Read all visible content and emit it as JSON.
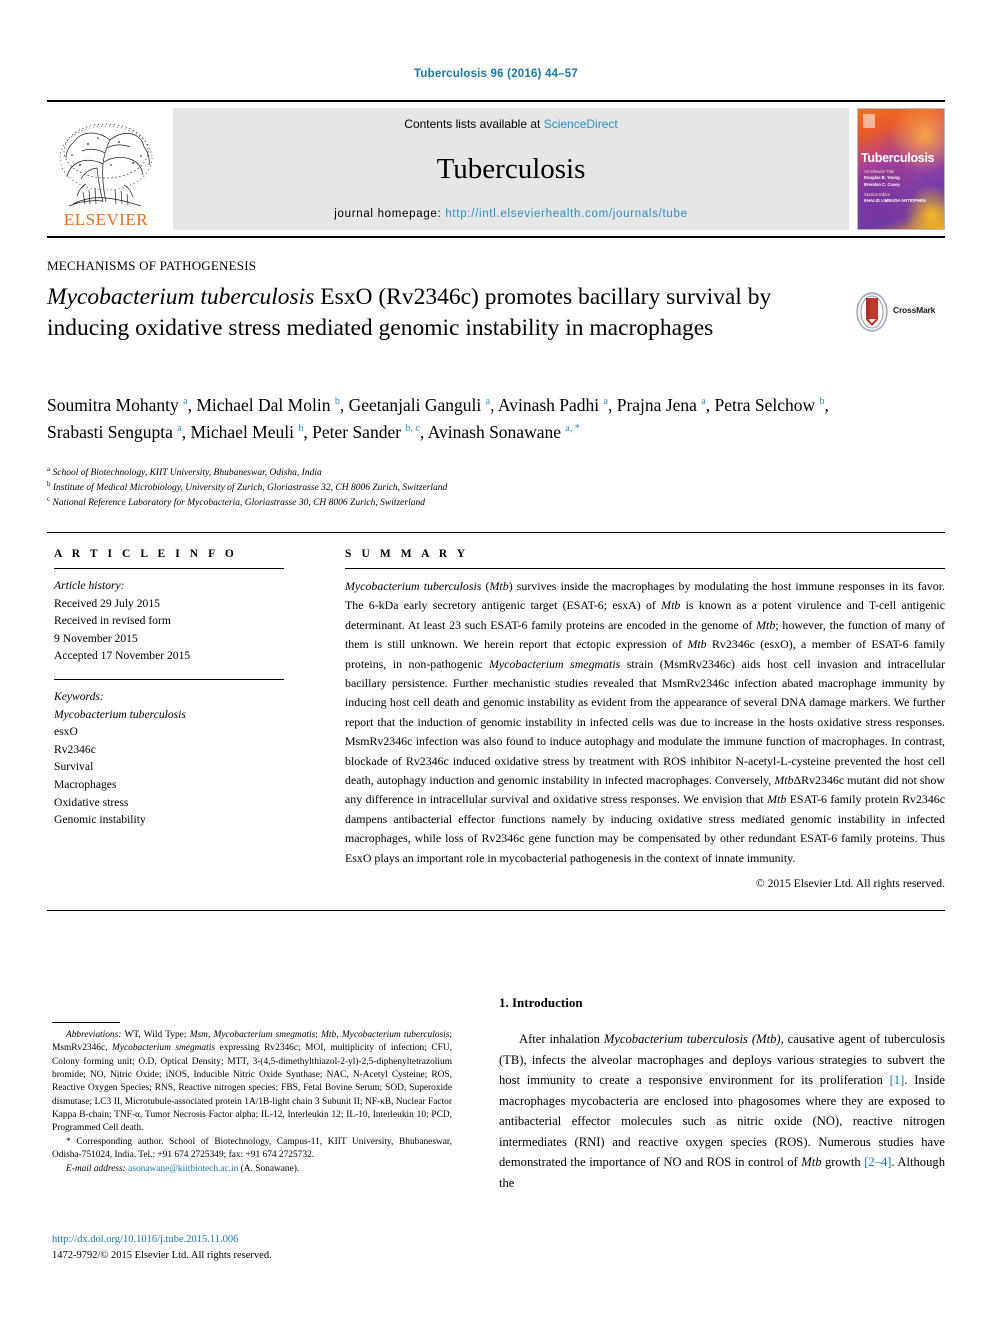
{
  "running_head": "Tuberculosis 96 (2016) 44–57",
  "masthead": {
    "contents_prefix": "Contents lists available at ",
    "contents_link": "ScienceDirect",
    "journal_name": "Tuberculosis",
    "homepage_prefix": "journal homepage: ",
    "homepage_url": "http://intl.elsevierhealth.com/journals/tube",
    "publisher": "ELSEVIER",
    "cover": {
      "title": "Tuberculosis",
      "line1": "An Elsevier Title",
      "line2": "Douglas B. Young",
      "line3": "Brendan C. Casey",
      "line4": "Section Editor",
      "line5": "KHALID LIMBADA ANTIOPHEN"
    }
  },
  "section_label": "MECHANISMS OF PATHOGENESIS",
  "title": {
    "part_italic_1": "Mycobacterium tuberculosis",
    "part_rest": " EsxO (Rv2346c) promotes bacillary survival by inducing oxidative stress mediated genomic instability in macrophages"
  },
  "crossmark": {
    "label": "CrossMark"
  },
  "authors": [
    {
      "name": "Soumitra Mohanty",
      "sup": "a",
      "sep": ", "
    },
    {
      "name": "Michael Dal Molin",
      "sup": "b",
      "sep": ", "
    },
    {
      "name": "Geetanjali Ganguli",
      "sup": "a",
      "sep": ", "
    },
    {
      "name": "Avinash Padhi",
      "sup": "a",
      "sep": ", "
    },
    {
      "name": "Prajna Jena",
      "sup": "a",
      "sep": ", "
    },
    {
      "name": "Petra Selchow",
      "sup": "b",
      "sep": ", "
    },
    {
      "name": "Srabasti Sengupta",
      "sup": "a",
      "sep": ", "
    },
    {
      "name": "Michael Meuli",
      "sup": "b",
      "sep": ", "
    },
    {
      "name": "Peter Sander",
      "sup": "b, c",
      "sep": ", "
    },
    {
      "name": "Avinash Sonawane",
      "sup": "a, *",
      "sep": ""
    }
  ],
  "affiliations": [
    {
      "sup": "a",
      "text": "School of Biotechnology, KIIT University, Bhubaneswar, Odisha, India"
    },
    {
      "sup": "b",
      "text": "Institute of Medical Microbiology, University of Zurich, Gloriastrasse 32, CH 8006 Zurich, Switzerland"
    },
    {
      "sup": "c",
      "text": "National Reference Laboratory for Mycobacteria, Gloriastrasse 30, CH 8006 Zurich, Switzerland"
    }
  ],
  "article_info": {
    "heading": "A R T I C L E   I N F O",
    "history_label": "Article history:",
    "history": [
      "Received 29 July 2015",
      "Received in revised form",
      "9 November 2015",
      "Accepted 17 November 2015"
    ],
    "keywords_label": "Keywords:",
    "keywords": [
      "Mycobacterium tuberculosis",
      "esxO",
      "Rv2346c",
      "Survival",
      "Macrophages",
      "Oxidative stress",
      "Genomic instability"
    ]
  },
  "summary": {
    "heading": "S U M M A R Y",
    "body_html": "<i>Mycobacterium tuberculosis</i> (<i>Mtb</i>) survives inside the macrophages by modulating the host immune responses in its favor. The 6-kDa early secretory antigenic target (ESAT-6; esxA) of <i>Mtb</i> is known as a potent virulence and T-cell antigenic determinant. At least 23 such ESAT-6 family proteins are encoded in the genome of <i>Mtb</i>; however, the function of many of them is still unknown. We herein report that ectopic expression of <i>Mtb</i> Rv2346c (esxO), a member of ESAT-6 family proteins, in non-pathogenic <i>Mycobacterium smegmatis</i> strain (MsmRv2346c) aids host cell invasion and intracellular bacillary persistence. Further mechanistic studies revealed that MsmRv2346c infection abated macrophage immunity by inducing host cell death and genomic instability as evident from the appearance of several DNA damage markers. We further report that the induction of genomic instability in infected cells was due to increase in the hosts oxidative stress responses. MsmRv2346c infection was also found to induce autophagy and modulate the immune function of macrophages. In contrast, blockade of Rv2346c induced oxidative stress by treatment with ROS inhibitor N-acetyl-L-cysteine prevented the host cell death, autophagy induction and genomic instability in infected macrophages. Conversely, <i>Mtb</i>ΔRv2346c mutant did not show any difference in intracellular survival and oxidative stress responses. We envision that <i>Mtb</i> ESAT-6 family protein Rv2346c dampens antibacterial effector functions namely by inducing oxidative stress mediated genomic instability in infected macrophages, while loss of Rv2346c gene function may be compensated by other redundant ESAT-6 family proteins. Thus EsxO plays an important role in mycobacterial pathogenesis in the context of innate immunity.",
    "copyright": "© 2015 Elsevier Ltd. All rights reserved."
  },
  "footnotes": {
    "abbreviations_html": "<i>Abbreviations:</i> WT, Wild Type; <i>Msm</i>, <i>Mycobacterium smegmatis</i>; <i>Mtb</i>, <i>Mycobacterium tuberculosis</i>; MsmRv2346c, <i>Mycobacterium smegmatis</i> expressing Rv2346c; MOI, multiplicity of infection; CFU, Colony forming unit; O.D, Optical Density; MTT, 3-(4,5-dimethylthiazol-2-yl)-2,5-diphenyltetrazolium bromide; NO, Nitric Oxide; iNOS, Inducible Nitric Oxide Synthase; NAC, N-Acetyl Cysteine; ROS, Reactive Oxygen Species; RNS, Reactive nitrogen species; FBS, Fetal Bovine Serum; SOD, Superoxide dismutase; LC3 II, Microtubule-associated protein 1A/1B-light chain 3 Subunit II; NF-κB, Nuclear Factor Kappa B-chain; TNF-α, Tumor Necrosis Factor alpha; IL-12, Interleukin 12; IL-10, Interleukin 10; PCD, Programmed Cell death.",
    "corresponding_html": "* Corresponding author. School of Biotechnology, Campus-11, KIIT University, Bhubaneswar, Odisha-751024, India. Tel.: +91 674 2725349; fax: +91 674 2725732.",
    "email_label": "E-mail address:",
    "email": "asonawane@kiitbiotech.ac.in",
    "email_suffix": "(A. Sonawane)."
  },
  "doi": {
    "url": "http://dx.doi.org/10.1016/j.tube.2015.11.006",
    "issn_line": "1472-9792/© 2015 Elsevier Ltd. All rights reserved."
  },
  "introduction": {
    "heading": "1. Introduction",
    "body_html": "After inhalation <i>Mycobacterium tuberculosis (Mtb)</i>, causative agent of tuberculosis (TB), infects the alveolar macrophages and deploys various strategies to subvert the host immunity to create a responsive environment for its proliferation <span class=\"ref\">[1]</span>. Inside macrophages mycobacteria are enclosed into phagosomes where they are exposed to antibacterial effector molecules such as nitric oxide (NO), reactive nitrogen intermediates (RNI) and reactive oxygen species (ROS). Numerous studies have demonstrated the importance of NO and ROS in control of <i>Mtb</i> growth <span class=\"ref\">[2–4]</span>. Although the"
  },
  "colors": {
    "link": "#1878a8",
    "sciencedirect": "#2b8fc4",
    "elsevier_orange": "#E9711C",
    "band_gray": "#e6e6e6"
  }
}
